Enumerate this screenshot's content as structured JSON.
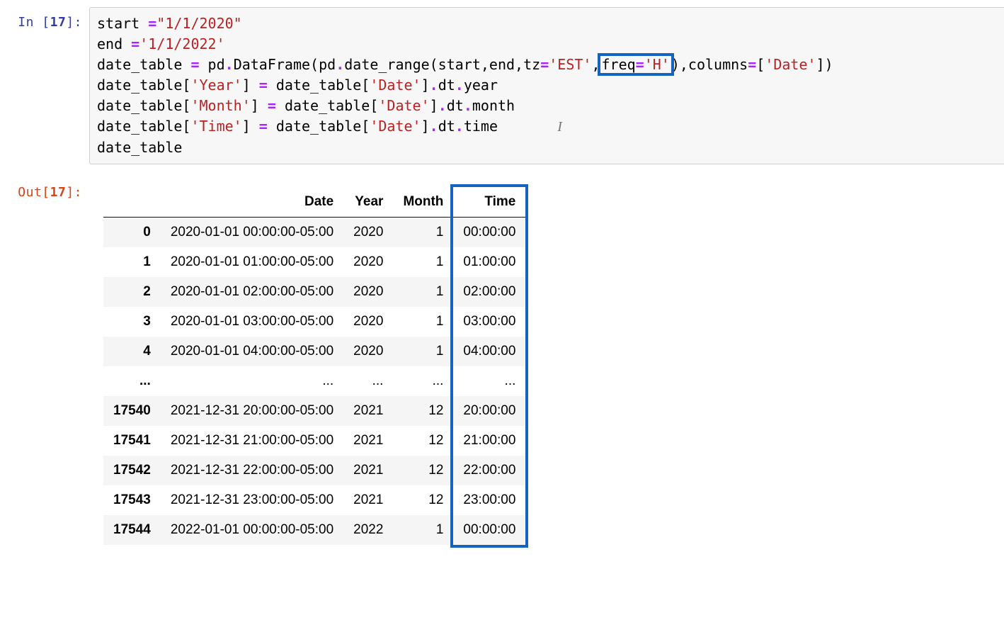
{
  "input": {
    "prompt_label": "In [",
    "number": "17",
    "prompt_close": "]:",
    "code": {
      "l1_a": "start ",
      "l1_eq": "=",
      "l1_str": "\"1/1/2020\"",
      "l2_a": "end ",
      "l2_eq": "=",
      "l2_str": "'1/1/2022'",
      "l3_a": "date_table ",
      "l3_eq": "= ",
      "l3_b": "pd",
      "l3_dot1": ".",
      "l3_c": "DataFrame(pd",
      "l3_dot2": ".",
      "l3_d": "date_range(start,end,tz",
      "l3_eq2": "=",
      "l3_str1": "'EST'",
      "l3_e": ",",
      "l3_hl_a": "freq",
      "l3_hl_eq": "=",
      "l3_hl_str": "'H'",
      "l3_f": "),columns",
      "l3_eq3": "=",
      "l3_g": "[",
      "l3_str3": "'Date'",
      "l3_h": "])",
      "l4_a": "date_table[",
      "l4_str1": "'Year'",
      "l4_b": "] ",
      "l4_eq": "= ",
      "l4_c": "date_table[",
      "l4_str2": "'Date'",
      "l4_d": "]",
      "l4_dot": ".",
      "l4_e": "dt",
      "l4_dot2": ".",
      "l4_f": "year",
      "l5_a": "date_table[",
      "l5_str1": "'Month'",
      "l5_b": "] ",
      "l5_eq": "= ",
      "l5_c": "date_table[",
      "l5_str2": "'Date'",
      "l5_d": "]",
      "l5_dot": ".",
      "l5_e": "dt",
      "l5_dot2": ".",
      "l5_f": "month",
      "l6_a": "date_table[",
      "l6_str1": "'Time'",
      "l6_b": "] ",
      "l6_eq": "= ",
      "l6_c": "date_table[",
      "l6_str2": "'Date'",
      "l6_d": "]",
      "l6_dot": ".",
      "l6_e": "dt",
      "l6_dot2": ".",
      "l6_f": "time",
      "l7": "date_table",
      "cursor": "I"
    }
  },
  "output": {
    "prompt_label": "Out[",
    "number": "17",
    "prompt_close": "]:",
    "columns": [
      "",
      "Date",
      "Year",
      "Month",
      "Time"
    ],
    "rows": [
      {
        "idx": "0",
        "date": "2020-01-01 00:00:00-05:00",
        "year": "2020",
        "month": "1",
        "time": "00:00:00"
      },
      {
        "idx": "1",
        "date": "2020-01-01 01:00:00-05:00",
        "year": "2020",
        "month": "1",
        "time": "01:00:00"
      },
      {
        "idx": "2",
        "date": "2020-01-01 02:00:00-05:00",
        "year": "2020",
        "month": "1",
        "time": "02:00:00"
      },
      {
        "idx": "3",
        "date": "2020-01-01 03:00:00-05:00",
        "year": "2020",
        "month": "1",
        "time": "03:00:00"
      },
      {
        "idx": "4",
        "date": "2020-01-01 04:00:00-05:00",
        "year": "2020",
        "month": "1",
        "time": "04:00:00"
      },
      {
        "idx": "...",
        "date": "...",
        "year": "...",
        "month": "...",
        "time": "...",
        "ellipsis": true
      },
      {
        "idx": "17540",
        "date": "2021-12-31 20:00:00-05:00",
        "year": "2021",
        "month": "12",
        "time": "20:00:00"
      },
      {
        "idx": "17541",
        "date": "2021-12-31 21:00:00-05:00",
        "year": "2021",
        "month": "12",
        "time": "21:00:00"
      },
      {
        "idx": "17542",
        "date": "2021-12-31 22:00:00-05:00",
        "year": "2021",
        "month": "12",
        "time": "22:00:00"
      },
      {
        "idx": "17543",
        "date": "2021-12-31 23:00:00-05:00",
        "year": "2021",
        "month": "12",
        "time": "23:00:00"
      },
      {
        "idx": "17544",
        "date": "2022-01-01 00:00:00-05:00",
        "year": "2022",
        "month": "1",
        "time": "00:00:00"
      }
    ]
  },
  "colors": {
    "highlight": "#1565C0"
  }
}
